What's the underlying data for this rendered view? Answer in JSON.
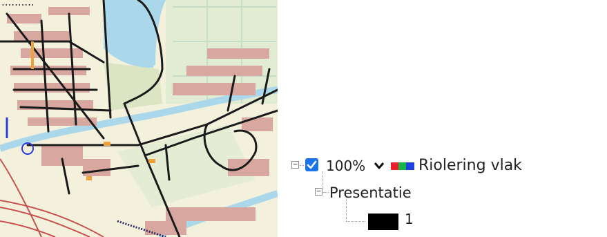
{
  "map": {
    "caption": "..........",
    "colors": {
      "land": "#f3f1dc",
      "water": "#aad8ea",
      "green": "#d8e6c3",
      "buildings": "#d8a8a0",
      "sewer": "#1a1a1a",
      "roads_main": "#c75050"
    }
  },
  "layer_tree": {
    "layer": {
      "checked": true,
      "opacity": "100%",
      "icon": "raster-layer-icon",
      "swatch_colors": [
        "#e8202a",
        "#19b34a",
        "#1f3fe0"
      ],
      "name": "Riolering vlak"
    },
    "presentation": {
      "label": "Presentatie"
    },
    "legend_items": [
      {
        "color": "#000000",
        "label": "1"
      }
    ]
  }
}
